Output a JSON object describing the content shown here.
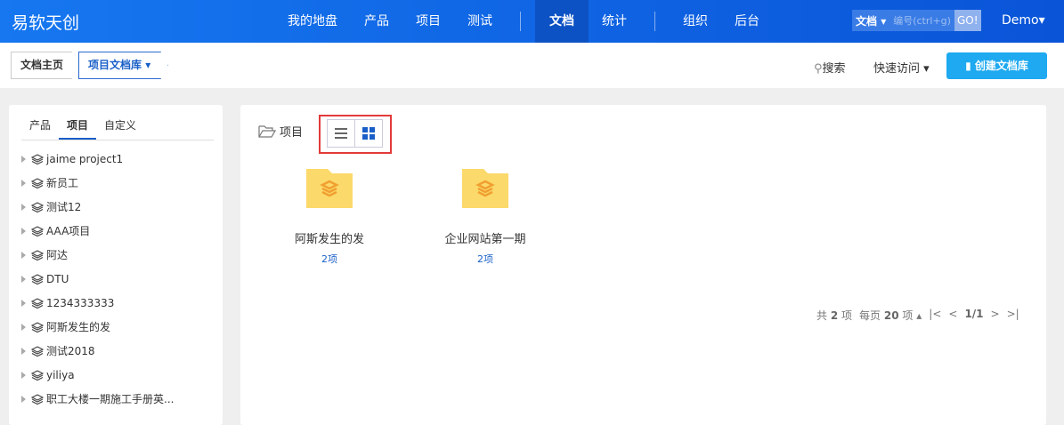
{
  "header": {
    "logo": "易软天创",
    "nav": [
      "我的地盘",
      "产品",
      "项目",
      "测试",
      "文档",
      "统计",
      "组织",
      "后台"
    ],
    "active": "文档",
    "search_type": "文档",
    "search_placeholder": "编号(ctrl+g)",
    "go": "GO!",
    "user": "Demo"
  },
  "breadcrumb": {
    "home": "文档主页",
    "current": "项目文档库"
  },
  "toolbar": {
    "search": "搜索",
    "quick": "快速访问",
    "create": "创建文档库"
  },
  "sidebar": {
    "tabs": [
      "产品",
      "项目",
      "自定义"
    ],
    "active_tab": "项目",
    "items": [
      "jaime project1",
      "新员工",
      "测试12",
      "AAA项目",
      "阿达",
      "DTU",
      "1234333333",
      "阿斯发生的发",
      "测试2018",
      "yiliya",
      "职工大楼一期施工手册英..."
    ]
  },
  "main": {
    "title": "项目",
    "view": "grid",
    "items": [
      {
        "name": "阿斯发生的发",
        "count": "2项"
      },
      {
        "name": "企业网站第一期",
        "count": "2项"
      }
    ]
  },
  "pager": {
    "total_prefix": "共",
    "total": "2",
    "total_suffix": "项",
    "per_prefix": "每页",
    "per": "20",
    "per_suffix": "项",
    "page": "1/1"
  },
  "colors": {
    "accent": "#1a5fc8",
    "folder": "#fcd96b",
    "folder_icon": "#f0a030"
  }
}
